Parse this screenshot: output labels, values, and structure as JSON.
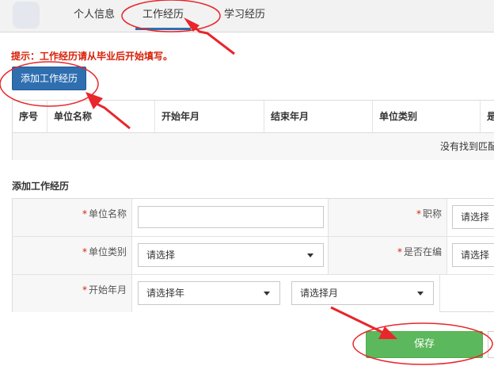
{
  "tabs": [
    {
      "label": "个人信息",
      "active": false
    },
    {
      "label": "工作经历",
      "active": true
    },
    {
      "label": "学习经历",
      "active": false
    }
  ],
  "hint": "提示：工作经历请从毕业后开始填写。",
  "add_button": "添加工作经历",
  "list": {
    "columns": [
      "序号",
      "单位名称",
      "开始年月",
      "结束年月",
      "单位类别",
      "是"
    ],
    "empty_text": "没有找到匹配"
  },
  "form": {
    "title": "添加工作经历",
    "required_mark": "*",
    "unit_name_label": "单位名称",
    "title_label": "职称",
    "unit_type_label": "单位类别",
    "on_staff_label": "是否在编",
    "start_label": "开始年月",
    "select_placeholder": "请选择",
    "select_year": "请选择年",
    "select_month": "请选择月",
    "unit_name_value": ""
  },
  "save_button": "保存",
  "colors": {
    "primary": "#2f6fb0",
    "success": "#5cb85c",
    "hint": "#d81e06",
    "annotation": "#e8262b"
  }
}
